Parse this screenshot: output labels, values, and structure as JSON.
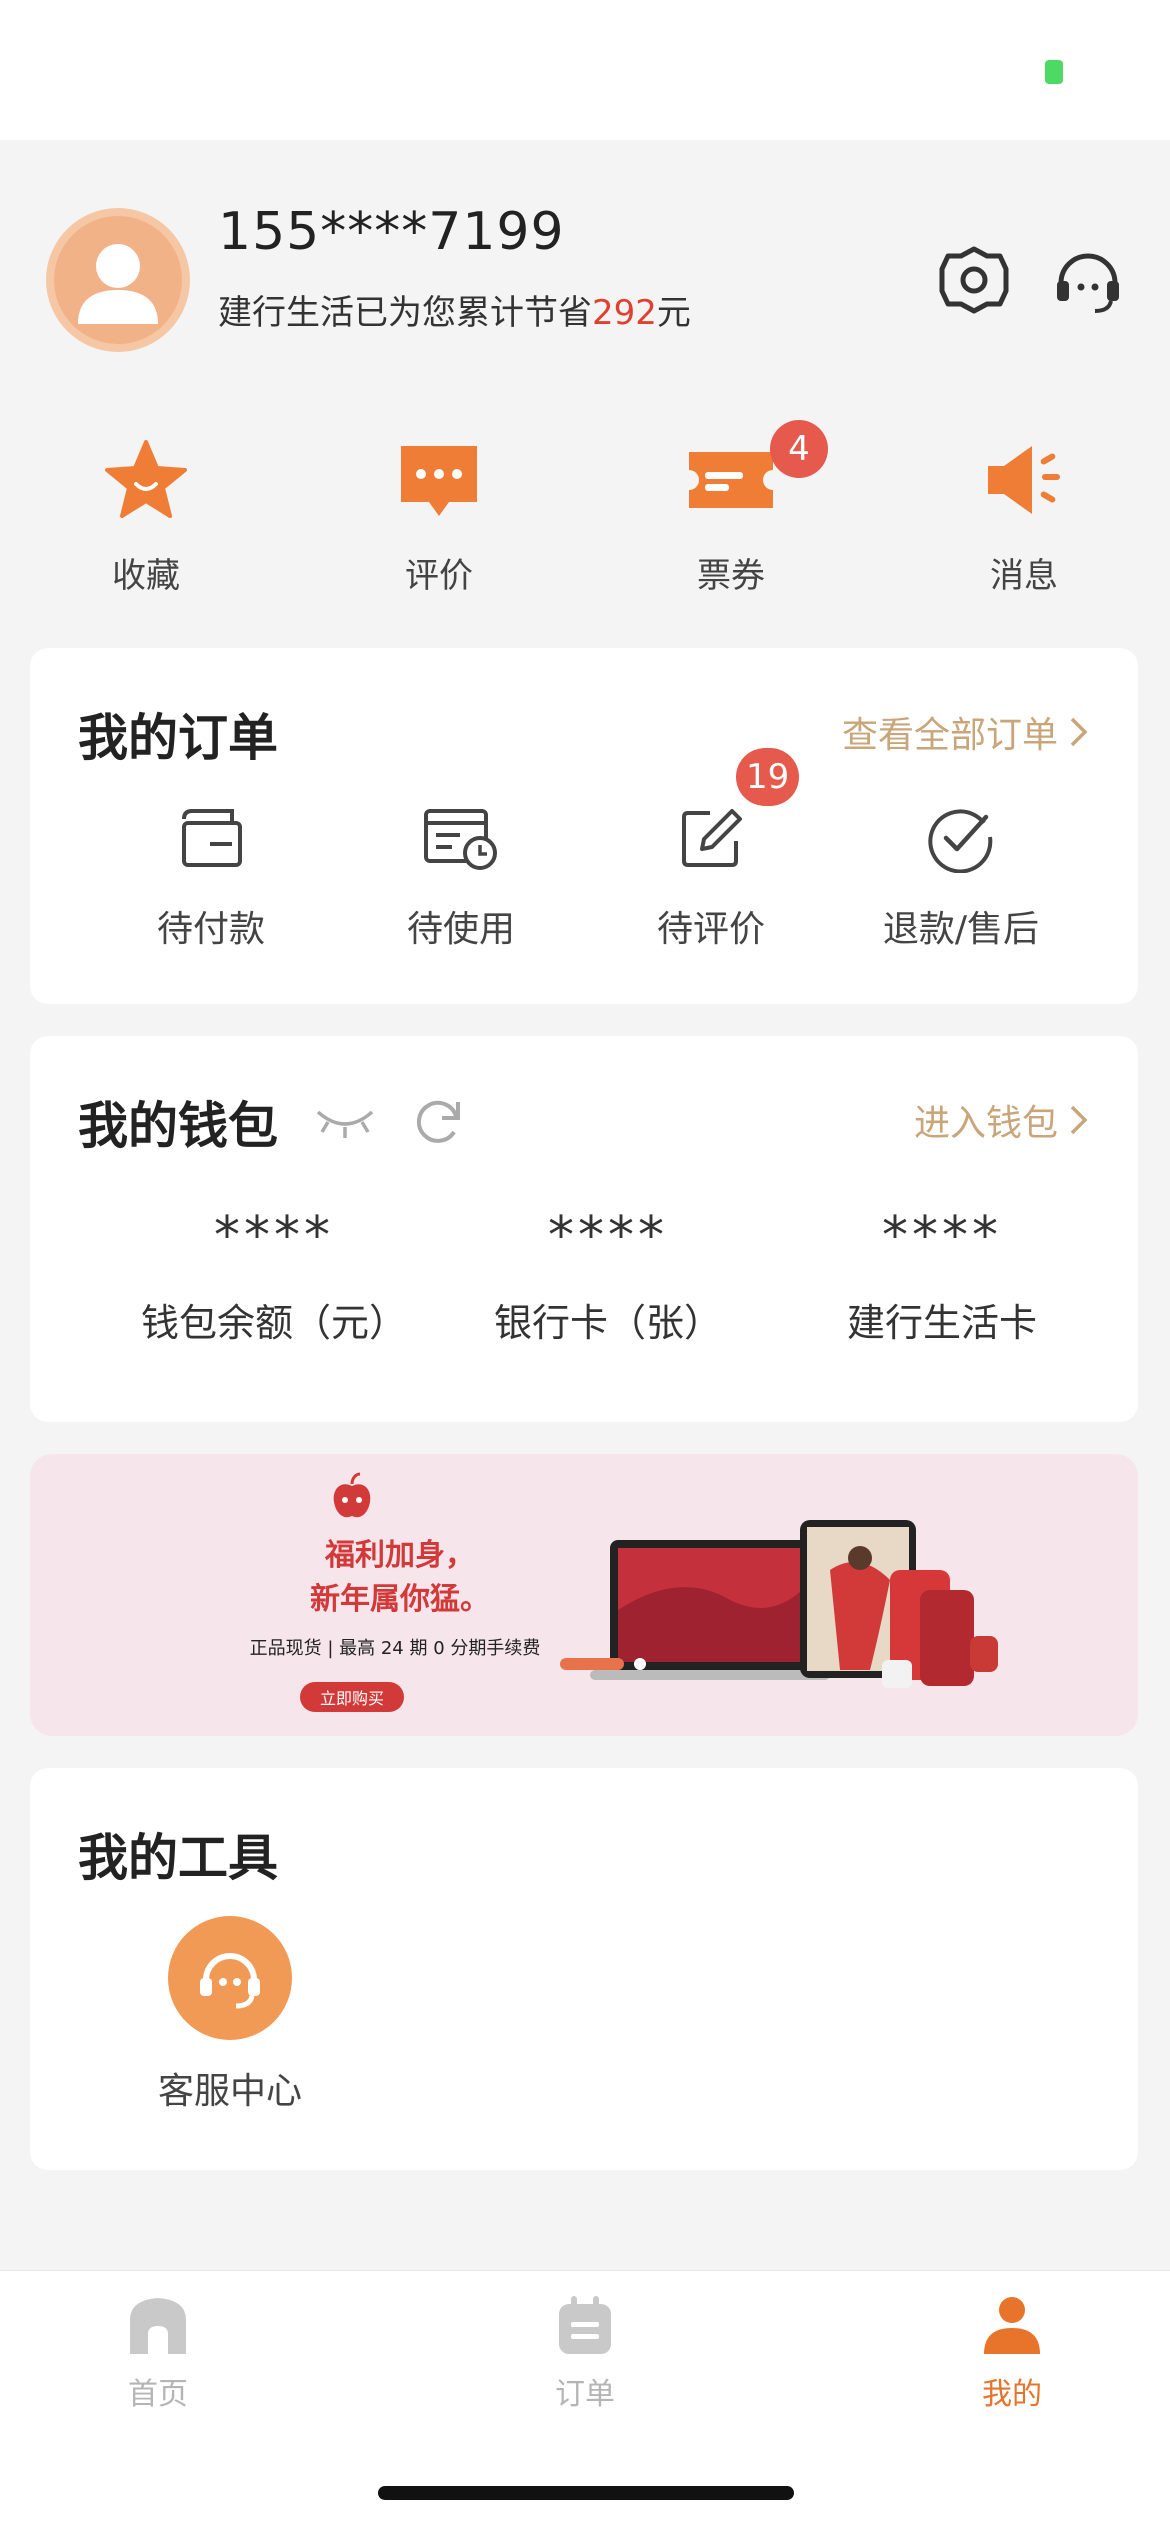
{
  "profile": {
    "phone": "155****7199",
    "savings_prefix": "建行生活已为您累计节省",
    "savings_amount": "292",
    "savings_suffix": "元"
  },
  "shortcuts": [
    {
      "label": "收藏",
      "icon": "star-icon"
    },
    {
      "label": "评价",
      "icon": "comment-icon"
    },
    {
      "label": "票券",
      "icon": "ticket-icon",
      "badge": "4"
    },
    {
      "label": "消息",
      "icon": "speaker-icon"
    }
  ],
  "orders": {
    "title": "我的订单",
    "view_all": "查看全部订单",
    "items": [
      {
        "label": "待付款",
        "icon": "wallet-icon"
      },
      {
        "label": "待使用",
        "icon": "calendar-clock-icon"
      },
      {
        "label": "待评价",
        "icon": "edit-icon",
        "badge": "19"
      },
      {
        "label": "退款/售后",
        "icon": "check-circle-icon"
      }
    ]
  },
  "wallet": {
    "title": "我的钱包",
    "enter": "进入钱包",
    "items": [
      {
        "value": "****",
        "label": "钱包余额（元）"
      },
      {
        "value": "****",
        "label": "银行卡（张）"
      },
      {
        "value": "****",
        "label": "建行生活卡"
      }
    ]
  },
  "banner": {
    "headline_line1": "福利加身，",
    "headline_line2": "新年属你猛。",
    "subtitle": "正品现货 | 最高 24 期 0 分期手续费",
    "button": "立即购买"
  },
  "tools": {
    "title": "我的工具",
    "items": [
      {
        "label": "客服中心",
        "icon": "headset-icon"
      }
    ]
  },
  "tabbar": {
    "tabs": [
      {
        "label": "首页",
        "icon": "home-icon",
        "active": false
      },
      {
        "label": "订单",
        "icon": "order-list-icon",
        "active": false
      },
      {
        "label": "我的",
        "icon": "user-icon",
        "active": true
      }
    ]
  },
  "colors": {
    "accent": "#e8732b",
    "link": "#c9a57a",
    "badge": "#e55a4c",
    "savings": "#e0402f"
  }
}
